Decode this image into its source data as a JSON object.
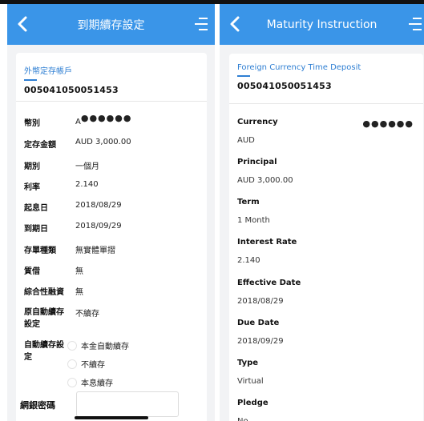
{
  "left": {
    "header_title": "到期續存設定",
    "account_type": "外幣定存帳戶",
    "account_number": "005041050051453",
    "currency_label": "幣別",
    "currency_prefix": "A",
    "currency_masked": "●●●●●●",
    "principal_label": "定存金額",
    "principal_value": "AUD 3,000.00",
    "term_label": "期別",
    "term_value": "一個月",
    "rate_label": "利率",
    "rate_value": "2.140",
    "start_label": "起息日",
    "start_value": "2018/08/29",
    "due_label": "到期日",
    "due_value": "2018/09/29",
    "type_label": "存單種類",
    "type_value": "無實體單摺",
    "pledge_label": "質借",
    "pledge_value": "無",
    "combined_label": "綜合性融資",
    "combined_value": "無",
    "orig_auto_label_1": "原自動續存",
    "orig_auto_label_2": "設定",
    "orig_auto_value": "不續存",
    "auto_label_1": "自動續存設",
    "auto_label_2": "定",
    "options": [
      "本金自動續存",
      "不續存",
      "本息續存"
    ],
    "password_label": "網銀密碼"
  },
  "right": {
    "header_title": "Maturity Instruction",
    "account_type": "Foreign Currency Time Deposit",
    "account_number": "005041050051453",
    "currency_label": "Currency",
    "currency_masked": "●●●●●●",
    "currency_value": "AUD",
    "principal_label": "Principal",
    "principal_value": "AUD 3,000.00",
    "term_label": "Term",
    "term_value": "1 Month",
    "rate_label": "Interest Rate",
    "rate_value": "2.140",
    "effective_label": "Effective Date",
    "effective_value": "2018/08/29",
    "due_label": "Due Date",
    "due_value": "2018/09/29",
    "type_label": "Type",
    "type_value": "Virtual",
    "pledge_label": "Pledge",
    "pledge_value": "No"
  }
}
